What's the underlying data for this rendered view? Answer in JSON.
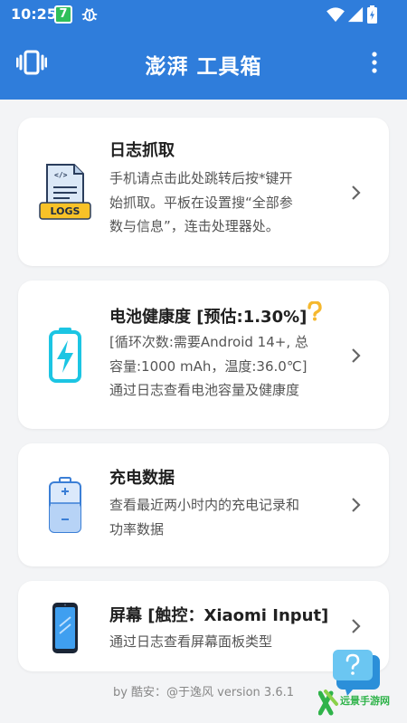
{
  "status_bar": {
    "time": "10:25",
    "app_badge": "7"
  },
  "toolbar": {
    "title": "澎湃 工具箱"
  },
  "cards": [
    {
      "title": "日志抓取",
      "icon_label": "LOGS",
      "icon_code": "</>",
      "desc_lines": [
        "手机请点击此处跳转后按*键开",
        "始抓取。平板在设置搜“全部参",
        "数与信息”，连击处理器处。"
      ]
    },
    {
      "title": "电池健康度 [预估:1.30%]",
      "desc_lines": [
        "[循环次数:需要Android 14+, 总",
        "容量:1000 mAh，温度:36.0℃]",
        "通过日志查看电池容量及健康度"
      ]
    },
    {
      "title": "充电数据",
      "desc_lines": [
        "查看最近两小时内的充电记录和",
        "功率数据"
      ]
    },
    {
      "title": "屏幕 [触控：Xiaomi Input]",
      "desc_lines": [
        "通过日志查看屏幕面板类型"
      ]
    }
  ],
  "footer": {
    "text": "by 酷安：@于逸风 version 3.6.1"
  },
  "watermark": {
    "text": "远景手游网"
  },
  "colors": {
    "primary": "#2f7ddb",
    "background": "#f3f4f6",
    "card": "#ffffff",
    "battery_cyan": "#1cc5e3",
    "help_yellow": "#f5b82e"
  }
}
